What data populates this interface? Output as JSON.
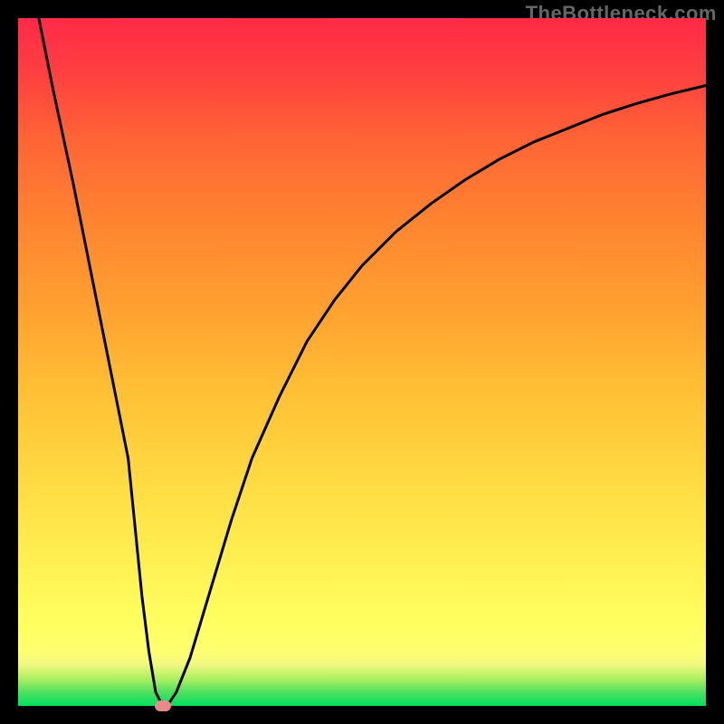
{
  "watermark": "TheBottleneck.com",
  "chart_data": {
    "type": "line",
    "title": "",
    "xlabel": "",
    "ylabel": "",
    "xrange": [
      0,
      100
    ],
    "yrange": [
      0,
      100
    ],
    "series": [
      {
        "name": "curve",
        "x": [
          3,
          5,
          8,
          10,
          12,
          14,
          16,
          17,
          18,
          19,
          20,
          21,
          22,
          23,
          25,
          28,
          31,
          34,
          38,
          42,
          46,
          50,
          55,
          60,
          65,
          70,
          75,
          80,
          85,
          90,
          95,
          100
        ],
        "y": [
          100,
          90,
          76,
          66,
          56,
          46,
          36,
          26,
          16,
          8,
          2,
          0,
          0.5,
          2,
          7,
          17,
          27,
          36,
          45,
          53,
          59,
          64,
          69,
          73,
          76.5,
          79.5,
          82,
          84,
          86,
          87.6,
          89,
          90.2
        ]
      }
    ],
    "marker": {
      "x": 21,
      "y": 0
    },
    "grid": false,
    "legend": false,
    "colors": {
      "curve": "#000000",
      "marker": "#e88a8a"
    }
  }
}
